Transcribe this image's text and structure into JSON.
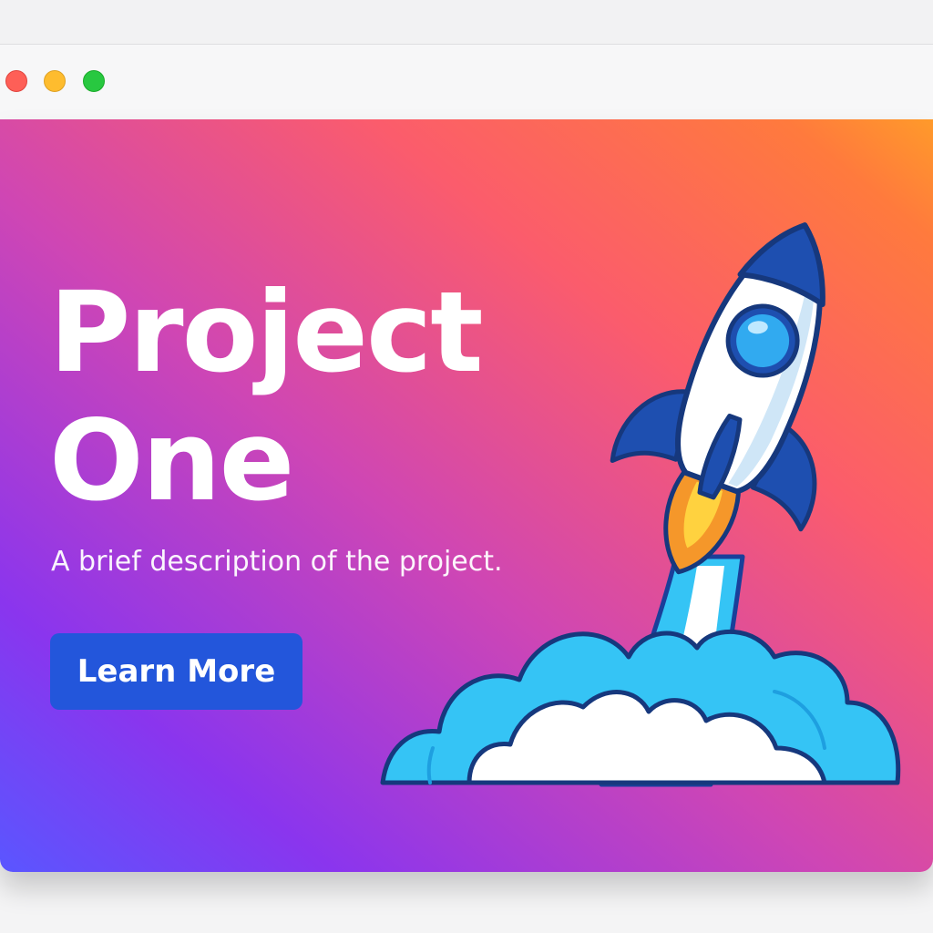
{
  "window": {
    "controls": [
      "close",
      "minimize",
      "maximize"
    ]
  },
  "hero": {
    "title_line1": "Project",
    "title_line2": "One",
    "description": "A brief description of the project.",
    "cta_label": "Learn More",
    "illustration": "rocket-launch-icon"
  },
  "colors": {
    "gradient_left": "#7b3bf5",
    "gradient_mid": "#e2508f",
    "gradient_right": "#ff7a3a",
    "button": "#2356db",
    "rocket_blue": "#1e4fb0",
    "cloud_blue": "#33c3f5",
    "flame_orange": "#f5972a"
  }
}
